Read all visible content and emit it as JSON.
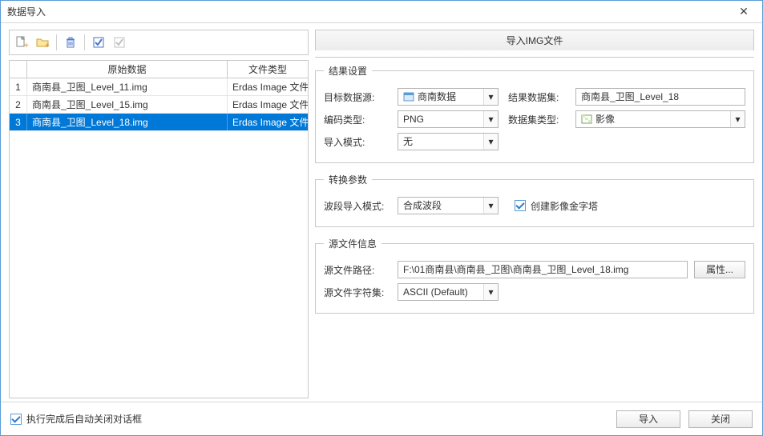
{
  "window": {
    "title": "数据导入"
  },
  "grid": {
    "col_name": "原始数据",
    "col_type": "文件类型",
    "rows": [
      {
        "n": "1",
        "name": "商南县_卫图_Level_11.img",
        "type": "Erdas Image 文件"
      },
      {
        "n": "2",
        "name": "商南县_卫图_Level_15.img",
        "type": "Erdas Image 文件"
      },
      {
        "n": "3",
        "name": "商南县_卫图_Level_18.img",
        "type": "Erdas Image 文件"
      }
    ],
    "selected_index": 2
  },
  "tab_title": "导入IMG文件",
  "result": {
    "legend": "结果设置",
    "target_ds_label": "目标数据源:",
    "target_ds_value": "商南数据",
    "result_ds_label": "结果数据集:",
    "result_ds_value": "商南县_卫图_Level_18",
    "encoding_label": "编码类型:",
    "encoding_value": "PNG",
    "dataset_type_label": "数据集类型:",
    "dataset_type_value": "影像",
    "import_mode_label": "导入模式:",
    "import_mode_value": "无"
  },
  "transform": {
    "legend": "转换参数",
    "band_mode_label": "波段导入模式:",
    "band_mode_value": "合成波段",
    "pyramid_label": "创建影像金字塔"
  },
  "source": {
    "legend": "源文件信息",
    "path_label": "源文件路径:",
    "path_value": "F:\\01商南县\\商南县_卫图\\商南县_卫图_Level_18.img",
    "props_btn": "属性...",
    "charset_label": "源文件字符集:",
    "charset_value": "ASCII (Default)"
  },
  "footer": {
    "auto_close": "执行完成后自动关闭对话框",
    "import_btn": "导入",
    "close_btn": "关闭"
  }
}
